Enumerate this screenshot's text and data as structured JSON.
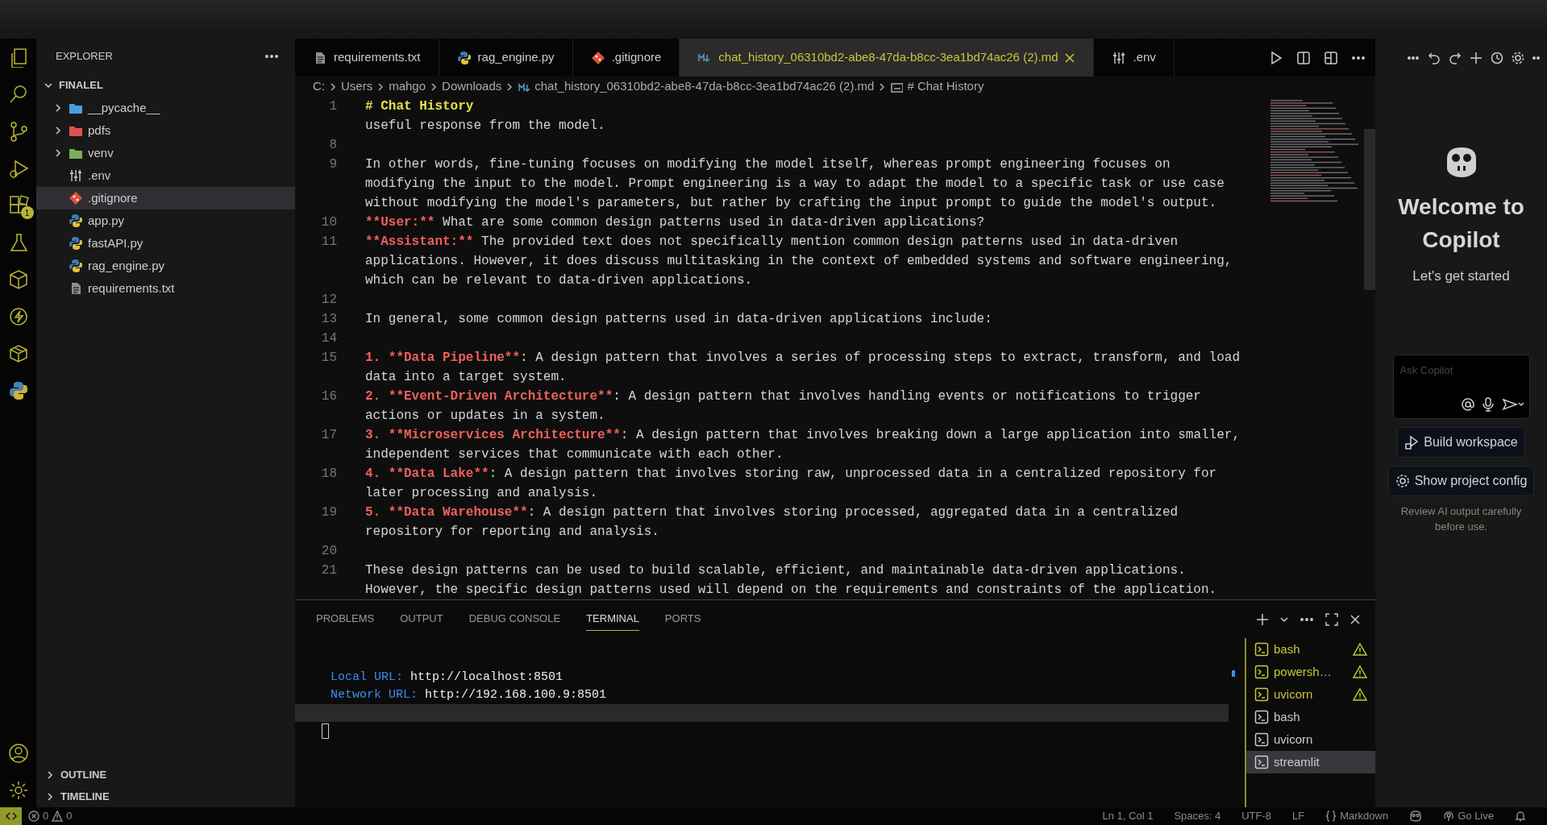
{
  "activity_bar": {
    "top": [
      {
        "kind": "files"
      },
      {
        "kind": "search"
      },
      {
        "kind": "source-control"
      },
      {
        "kind": "run-debug"
      },
      {
        "kind": "extensions",
        "badge": "1"
      },
      {
        "kind": "testing"
      },
      {
        "kind": "cube"
      },
      {
        "kind": "lightning"
      },
      {
        "kind": "package"
      },
      {
        "kind": "python"
      }
    ],
    "bottom": [
      {
        "kind": "account"
      },
      {
        "kind": "settings"
      }
    ]
  },
  "sidebar": {
    "title": "EXPLORER",
    "folder": {
      "label": "FINALEL",
      "expanded": true,
      "children": [
        {
          "label": "__pycache__",
          "kind": "folder",
          "expanded": false,
          "color": "#4a9fe0",
          "selected": false
        },
        {
          "label": "pdfs",
          "kind": "folder",
          "expanded": false,
          "color": "#e05252",
          "selected": false
        },
        {
          "label": "venv",
          "kind": "folder",
          "expanded": false,
          "color": "#7cae5a",
          "selected": false
        },
        {
          "label": ".env",
          "kind": "settings-file",
          "selected": false
        },
        {
          "label": ".gitignore",
          "kind": "git-file",
          "selected": true
        },
        {
          "label": "app.py",
          "kind": "python-file",
          "selected": false
        },
        {
          "label": "fastAPI.py",
          "kind": "python-file",
          "selected": false
        },
        {
          "label": "rag_engine.py",
          "kind": "python-file",
          "selected": false
        },
        {
          "label": "requirements.txt",
          "kind": "text-file",
          "selected": false
        }
      ]
    },
    "sections": [
      {
        "label": "OUTLINE",
        "expanded": false
      },
      {
        "label": "TIMELINE",
        "expanded": false
      }
    ]
  },
  "tabs": [
    {
      "label": "requirements.txt",
      "kind": "text-file",
      "selected": false
    },
    {
      "label": "rag_engine.py",
      "kind": "python-file",
      "selected": false
    },
    {
      "label": ".gitignore",
      "kind": "git-file",
      "selected": false
    },
    {
      "label": "chat_history_06310bd2-abe8-47da-b8cc-3ea1bd74ac26 (2).md",
      "kind": "markdown-file",
      "selected": true
    },
    {
      "label": ".env",
      "kind": "settings-file",
      "selected": false
    }
  ],
  "breadcrumb": [
    {
      "label": "C:",
      "kind": "folder"
    },
    {
      "label": "Users",
      "kind": "folder"
    },
    {
      "label": "mahgo",
      "kind": "folder"
    },
    {
      "label": "Downloads",
      "kind": "folder"
    },
    {
      "label": "chat_history_06310bd2-abe8-47da-b8cc-3ea1bd74ac26 (2).md",
      "kind": "markdown-file"
    },
    {
      "label": "# Chat History",
      "kind": "symbol"
    }
  ],
  "editor": {
    "lines": [
      {
        "number": "1",
        "rows": [
          [
            {
              "text": "# Chat History",
              "kind": "heading"
            }
          ]
        ]
      },
      {
        "rows": [
          [
            {
              "text": "useful response from the model."
            }
          ]
        ]
      },
      {
        "number": "8"
      },
      {
        "number": "9",
        "rows": [
          [
            {
              "text": "In other words, fine-tuning focuses on modifying the model itself, whereas prompt engineering focuses on"
            }
          ],
          [
            {
              "text": "modifying the input to the model. Prompt engineering is a way to adapt the model to a specific task or use case"
            }
          ],
          [
            {
              "text": "without modifying the model's parameters, but rather by crafting the input prompt to guide the model's output."
            }
          ]
        ]
      },
      {
        "number": "10",
        "rows": [
          [
            {
              "text": "**User:**",
              "kind": "strong"
            },
            {
              "text": " What are some common design patterns used in data-driven applications?"
            }
          ]
        ]
      },
      {
        "number": "11",
        "rows": [
          [
            {
              "text": "**Assistant:**",
              "kind": "strong"
            },
            {
              "text": " The provided text does not specifically mention common design patterns used in data-driven"
            }
          ],
          [
            {
              "text": "applications. However, it does discuss multitasking in the context of embedded systems and software engineering,"
            }
          ],
          [
            {
              "text": "which can be relevant to data-driven applications."
            }
          ]
        ]
      },
      {
        "number": "12"
      },
      {
        "number": "13",
        "rows": [
          [
            {
              "text": "In general, some common design patterns used in data-driven applications include:"
            }
          ]
        ]
      },
      {
        "number": "14"
      },
      {
        "number": "15",
        "rows": [
          [
            {
              "text": "1. **Data Pipeline**",
              "kind": "strong"
            },
            {
              "text": ": A design pattern that involves a series of processing steps to extract, transform, and load"
            }
          ],
          [
            {
              "text": "data into a target system."
            }
          ]
        ]
      },
      {
        "number": "16",
        "rows": [
          [
            {
              "text": "2. **Event-Driven Architecture**",
              "kind": "strong"
            },
            {
              "text": ": A design pattern that involves handling events or notifications to trigger"
            }
          ],
          [
            {
              "text": "actions or updates in a system."
            }
          ]
        ]
      },
      {
        "number": "17",
        "rows": [
          [
            {
              "text": "3. **Microservices Architecture**",
              "kind": "strong"
            },
            {
              "text": ": A design pattern that involves breaking down a large application into smaller,"
            }
          ],
          [
            {
              "text": "independent services that communicate with each other."
            }
          ]
        ]
      },
      {
        "number": "18",
        "rows": [
          [
            {
              "text": "4. **Data Lake**",
              "kind": "strong"
            },
            {
              "text": ": A design pattern that involves storing raw, unprocessed data in a centralized repository for"
            }
          ],
          [
            {
              "text": "later processing and analysis."
            }
          ]
        ]
      },
      {
        "number": "19",
        "rows": [
          [
            {
              "text": "5. **Data Warehouse**",
              "kind": "strong"
            },
            {
              "text": ": A design pattern that involves storing processed, aggregated data in a centralized"
            }
          ],
          [
            {
              "text": "repository for reporting and analysis."
            }
          ]
        ]
      },
      {
        "number": "20"
      },
      {
        "number": "21",
        "rows": [
          [
            {
              "text": "These design patterns can be used to build scalable, efficient, and maintainable data-driven applications."
            }
          ],
          [
            {
              "text": "However, the specific design patterns used will depend on the requirements and constraints of the application."
            }
          ]
        ]
      }
    ]
  },
  "panel": {
    "tabs": [
      {
        "label": "PROBLEMS",
        "selected": false
      },
      {
        "label": "OUTPUT",
        "selected": false
      },
      {
        "label": "DEBUG CONSOLE",
        "selected": false
      },
      {
        "label": "TERMINAL",
        "selected": true
      },
      {
        "label": "PORTS",
        "selected": false
      }
    ],
    "terminal_lines": [
      {
        "label": "Local URL:",
        "value": "http://localhost:8501"
      },
      {
        "label": "Network URL:",
        "value": "http://192.168.100.9:8501"
      }
    ],
    "terminals": [
      {
        "label": "bash",
        "warning": true,
        "selected": false
      },
      {
        "label": "powersh…",
        "warning": true,
        "selected": false
      },
      {
        "label": "uvicorn",
        "warning": true,
        "selected": false
      },
      {
        "label": "bash",
        "warning": false,
        "selected": false
      },
      {
        "label": "uvicorn",
        "warning": false,
        "selected": false
      },
      {
        "label": "streamlit",
        "warning": false,
        "selected": true
      }
    ]
  },
  "copilot": {
    "title": "Welcome to Copilot",
    "subtitle": "Let's get started",
    "input": {
      "placeholder": "Ask Copilot"
    },
    "buttons": [
      {
        "label": "Build workspace",
        "kind": "build"
      },
      {
        "label": "Show project config",
        "kind": "config"
      }
    ],
    "note": "Review AI output carefully before use."
  },
  "status_bar": {
    "errors": "0",
    "warnings": "0",
    "items": [
      {
        "label": "Ln 1, Col 1"
      },
      {
        "label": "Spaces: 4"
      },
      {
        "label": "UTF-8"
      },
      {
        "label": "LF"
      },
      {
        "label": "Markdown",
        "kind": "language"
      },
      {
        "kind": "copilot"
      },
      {
        "label": "Go Live",
        "kind": "live"
      },
      {
        "kind": "bell"
      }
    ]
  }
}
